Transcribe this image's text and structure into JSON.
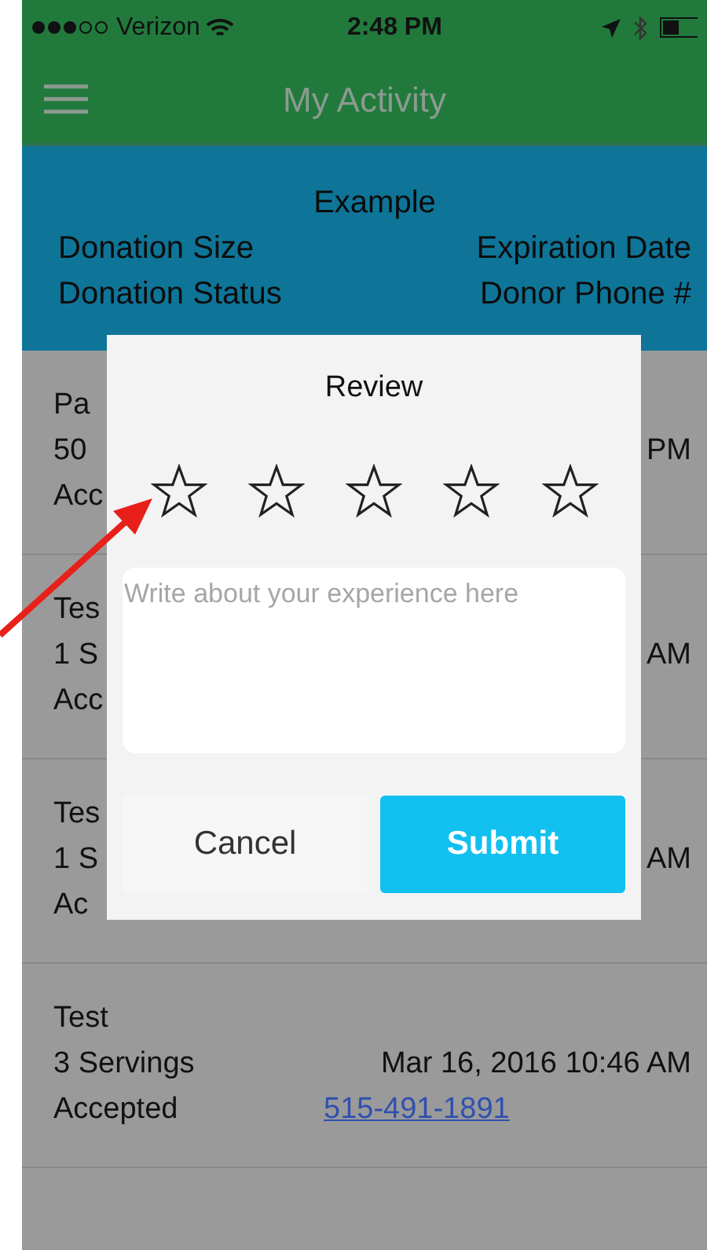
{
  "status_bar": {
    "carrier": "Verizon",
    "time": "2:48 PM"
  },
  "nav": {
    "title": "My Activity"
  },
  "header": {
    "title": "Example",
    "lines": [
      {
        "left": "Donation Size",
        "right": "Expiration Date"
      },
      {
        "left": "Donation Status",
        "right": "Donor Phone #"
      }
    ]
  },
  "donations": [
    {
      "name": "Pa",
      "servings": "50",
      "date": "PM",
      "status": "Acc"
    },
    {
      "name": "Tes",
      "servings": "1 S",
      "date": "AM",
      "status": "Acc"
    },
    {
      "name": "Tes",
      "servings": "1 S",
      "date": "AM",
      "status": "Ac"
    },
    {
      "name": "Test",
      "servings": "3 Servings",
      "date": "Mar 16, 2016 10:46 AM",
      "status": "Accepted",
      "phone": "515-491-1891"
    }
  ],
  "review_dialog": {
    "title": "Review",
    "stars": 0,
    "placeholder": "Write about your experience here",
    "buttons": [
      {
        "label": "Cancel",
        "kind": "secondary"
      },
      {
        "label": "Submit",
        "kind": "primary"
      }
    ]
  }
}
